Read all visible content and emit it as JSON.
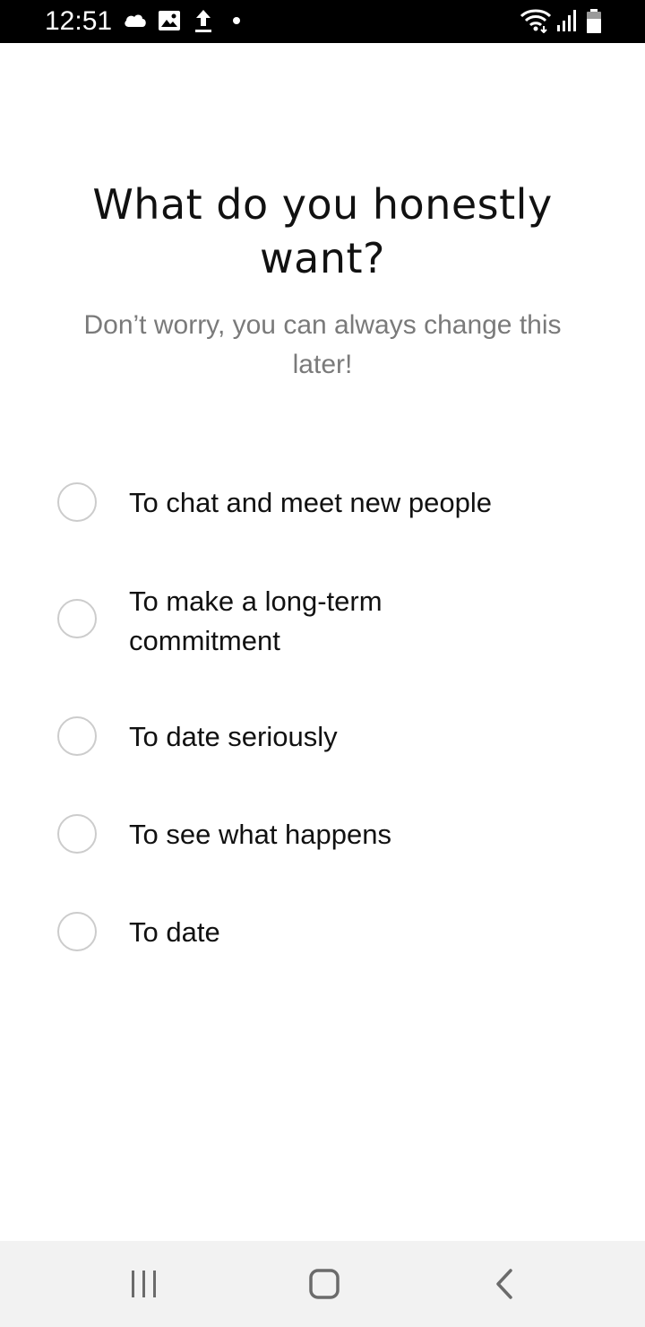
{
  "status_bar": {
    "time": "12:51",
    "left_icons": [
      "cloud-icon",
      "image-icon",
      "upload-icon",
      "dot-icon"
    ],
    "right_icons": [
      "wifi-icon",
      "signal-icon",
      "battery-icon"
    ]
  },
  "question": {
    "title_line1": "What do you honestly",
    "title_line2": "want?",
    "subtitle_line1": "Don’t worry, you can always change this",
    "subtitle_line2": "later!"
  },
  "options": [
    {
      "label_line1": "To chat and meet new people",
      "label_line2": "",
      "selected": false
    },
    {
      "label_line1": "To make a long-term",
      "label_line2": "commitment",
      "selected": false
    },
    {
      "label_line1": "To date seriously",
      "label_line2": "",
      "selected": false
    },
    {
      "label_line1": "To see what happens",
      "label_line2": "",
      "selected": false
    },
    {
      "label_line1": "To date",
      "label_line2": "",
      "selected": false
    }
  ],
  "nav_bar": {
    "buttons": [
      "recent-apps-icon",
      "home-icon",
      "back-icon"
    ]
  },
  "colors": {
    "status_bar_bg": "#000000",
    "title_text": "#111111",
    "subtitle_text": "#7a7a7a",
    "radio_border": "#cccccc",
    "nav_bar_bg": "#f2f2f2",
    "nav_icon": "#6b6b6b"
  }
}
